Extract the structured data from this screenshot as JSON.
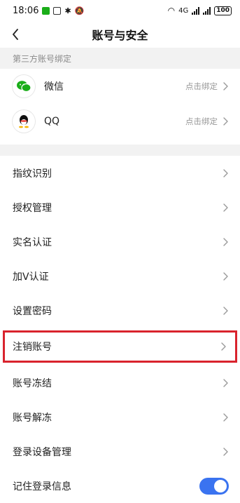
{
  "status_bar": {
    "time": "18:06",
    "battery": "100",
    "network_label": "4G"
  },
  "nav": {
    "title": "账号与安全",
    "back_icon": "back-arrow-icon"
  },
  "third_party": {
    "header": "第三方账号绑定",
    "items": [
      {
        "name": "微信",
        "status": "点击绑定",
        "icon": "wechat-icon",
        "color": "#1aad19"
      },
      {
        "name": "QQ",
        "status": "点击绑定",
        "icon": "qq-icon",
        "color": "#111111"
      }
    ]
  },
  "menu": {
    "items": [
      {
        "label": "指纹识别"
      },
      {
        "label": "授权管理"
      },
      {
        "label": "实名认证"
      },
      {
        "label": "加V认证"
      },
      {
        "label": "设置密码"
      },
      {
        "label": "注销账号",
        "highlighted": true
      },
      {
        "label": "账号冻结"
      },
      {
        "label": "账号解冻"
      },
      {
        "label": "登录设备管理"
      }
    ],
    "remember_login": {
      "label": "记住登录信息",
      "enabled": true
    }
  },
  "colors": {
    "accent": "#3a73f0",
    "highlight_border": "#d9232d"
  }
}
